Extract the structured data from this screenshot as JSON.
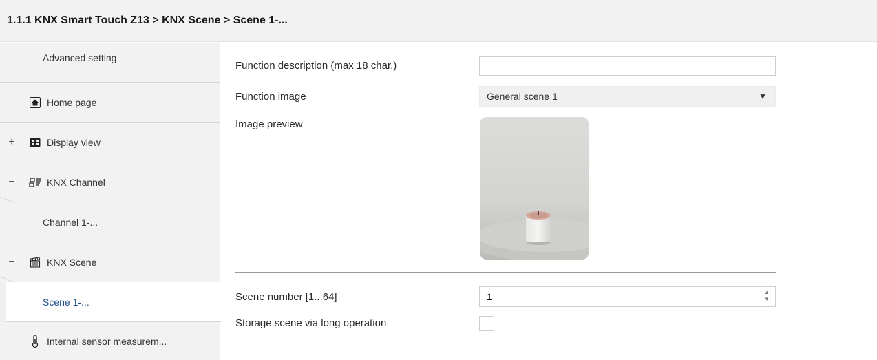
{
  "breadcrumb": "1.1.1 KNX Smart Touch Z13 > KNX Scene > Scene 1-...",
  "sidebar": {
    "items": [
      {
        "label": "Advanced setting",
        "expander": "",
        "icon": ""
      },
      {
        "label": "Home page",
        "expander": "",
        "icon": "home-icon"
      },
      {
        "label": "Display view",
        "expander": "+",
        "icon": "display-view-icon"
      },
      {
        "label": "KNX Channel",
        "expander": "−",
        "icon": "channel-icon"
      },
      {
        "label": "Channel 1-...",
        "expander": "",
        "icon": ""
      },
      {
        "label": "KNX Scene",
        "expander": "−",
        "icon": "scene-icon"
      },
      {
        "label": "Scene 1-...",
        "expander": "",
        "icon": "",
        "active": true
      },
      {
        "label": "Internal sensor measurem...",
        "expander": "",
        "icon": "thermometer-icon"
      }
    ]
  },
  "main": {
    "function_description": {
      "label": "Function description (max 18 char.)",
      "value": ""
    },
    "function_image": {
      "label": "Function image",
      "value": "General scene 1"
    },
    "image_preview": {
      "label": "Image preview"
    },
    "scene_number": {
      "label": "Scene number [1...64]",
      "value": "1"
    },
    "storage_scene": {
      "label": "Storage scene via long operation",
      "checked": false
    }
  }
}
